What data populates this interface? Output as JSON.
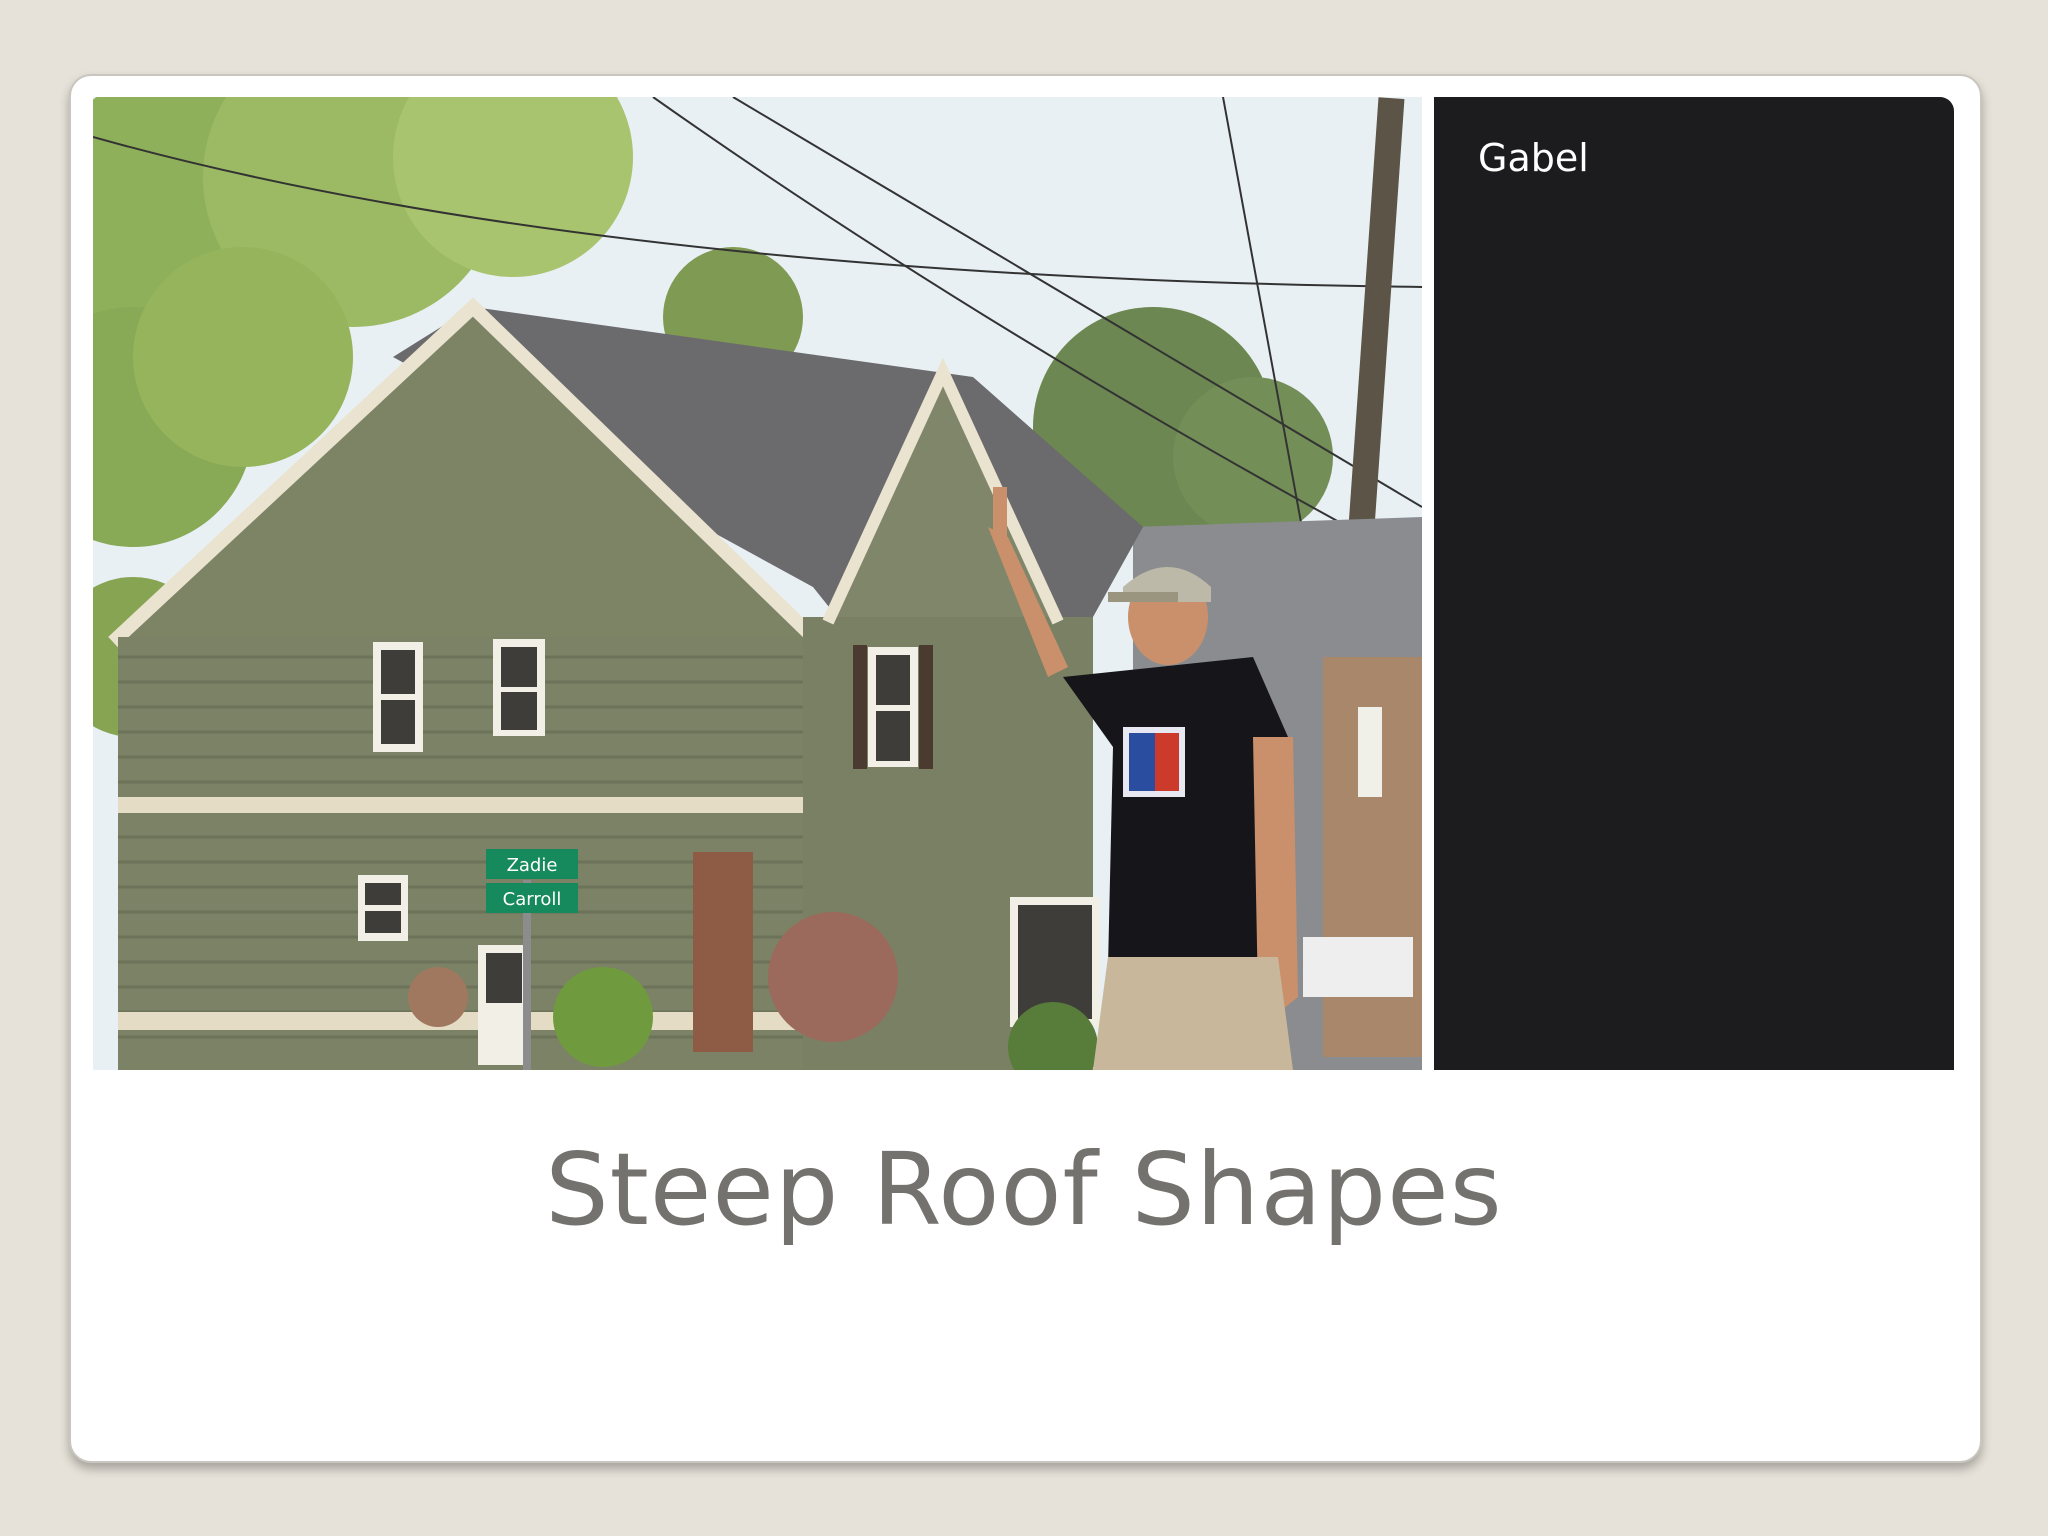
{
  "slide": {
    "title": "Steep Roof Shapes",
    "caption": "Gabel"
  },
  "photo": {
    "subject": "house-with-steep-gable-roof-and-man-pointing-up",
    "street_sign_top": "Zadie",
    "street_sign_bottom": "Carroll"
  },
  "colors": {
    "background": "#e6e2d9",
    "slide": "#ffffff",
    "caption_panel": "#1c1b1e",
    "title_text": "#74726e",
    "caption_text": "#ffffff"
  }
}
